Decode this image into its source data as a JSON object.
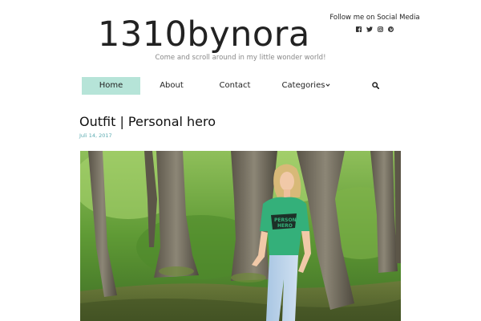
{
  "site": {
    "title": "1310bynora",
    "tagline": "Come and scroll around in my little wonder world!"
  },
  "social": {
    "heading": "Follow me on Social Media",
    "icons": [
      "facebook-icon",
      "twitter-icon",
      "instagram-icon",
      "pinterest-icon"
    ]
  },
  "nav": {
    "items": [
      {
        "label": "Home",
        "active": true
      },
      {
        "label": "About"
      },
      {
        "label": "Contact"
      },
      {
        "label": "Categories"
      }
    ],
    "search_icon": "search-icon",
    "active_color": "#b6e4d8"
  },
  "post": {
    "title": "Outfit | Personal hero",
    "date": "Juli 14, 2017",
    "date_color": "#5aaab0",
    "image_subject": "woman in green t-shirt leaning on a tree in a forest",
    "shirt_print": "PERSONAL HERO"
  }
}
